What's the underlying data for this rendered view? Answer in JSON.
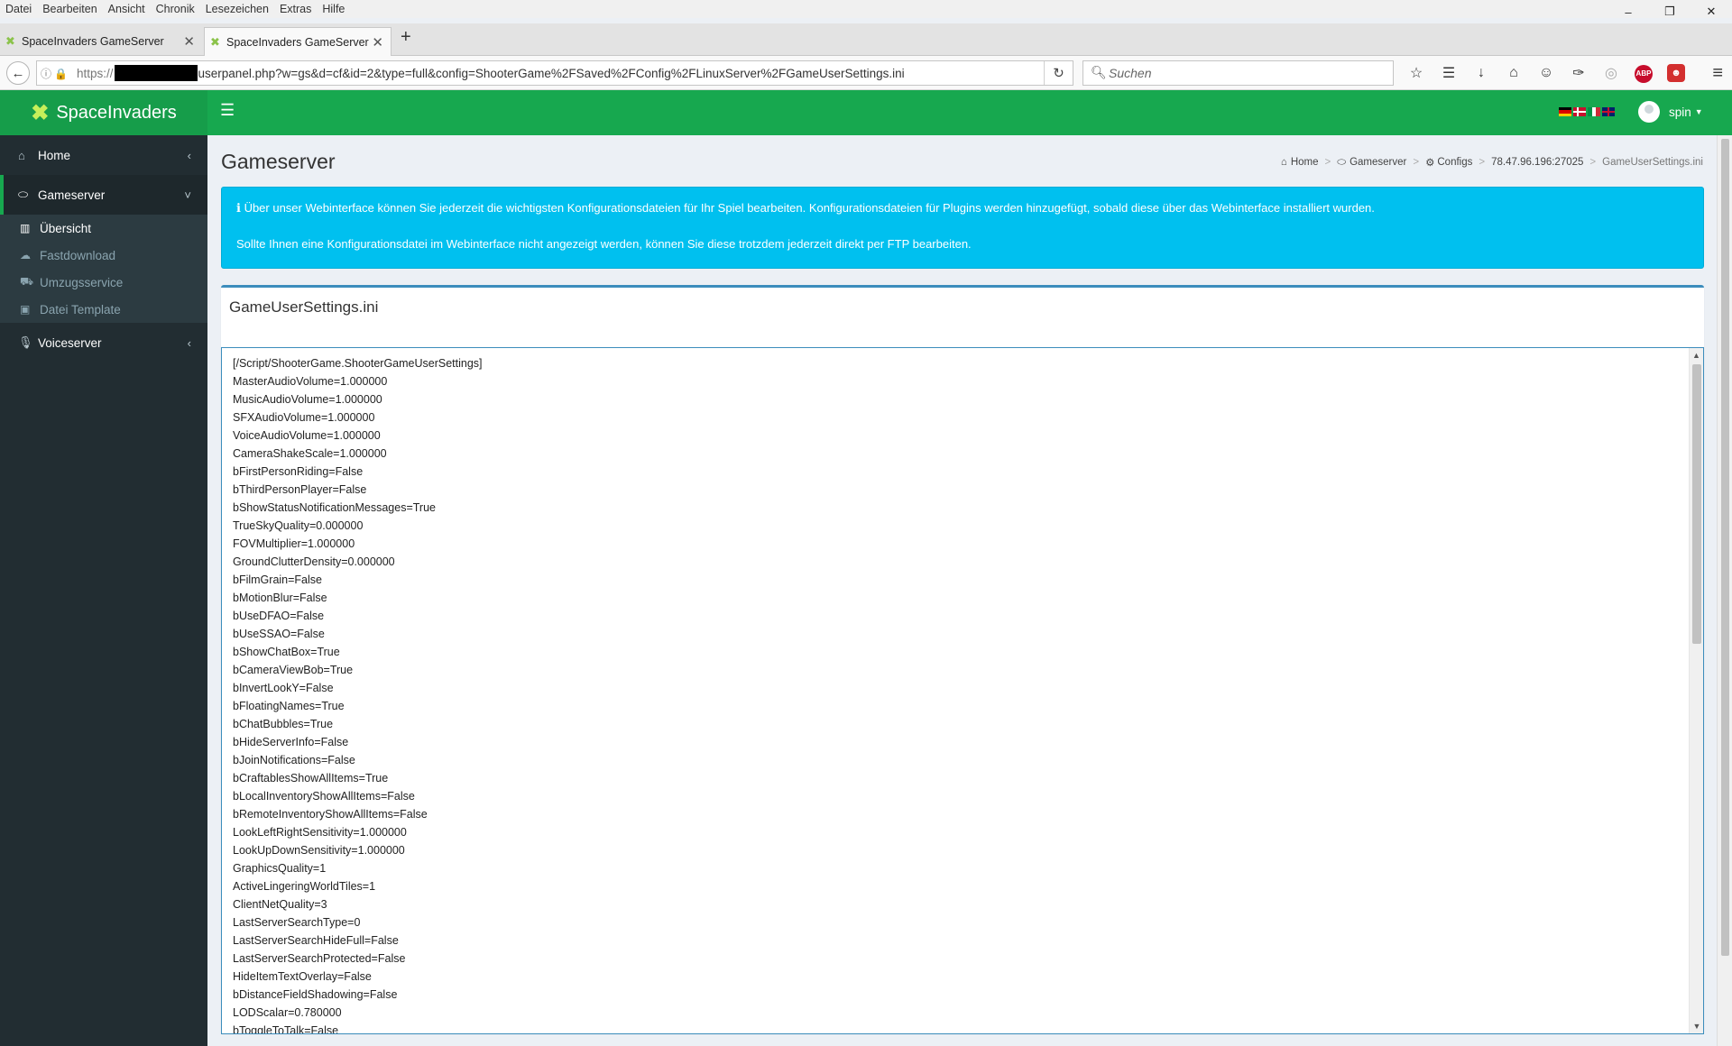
{
  "browser": {
    "menu": [
      "Datei",
      "Bearbeiten",
      "Ansicht",
      "Chronik",
      "Lesezeichen",
      "Extras",
      "Hilfe"
    ],
    "tabs": [
      {
        "title": "SpaceInvaders GameServer",
        "active": false
      },
      {
        "title": "SpaceInvaders GameServer",
        "active": true
      }
    ],
    "url_proto": "https://",
    "url_rest": "userpanel.php?w=gs&d=cf&id=2&type=full&config=ShooterGame%2FSaved%2FConfig%2FLinuxServer%2FGameUserSettings.ini",
    "search_placeholder": "Suchen",
    "toolbar_icons": [
      "bookmark-star-icon",
      "reading-list-icon",
      "download-icon",
      "home-icon",
      "chat-icon",
      "pocket-icon",
      "sync-icon",
      "adblock-icon",
      "extension-icon"
    ],
    "adblock_label": "ABP"
  },
  "app": {
    "brand": "SpaceInvaders",
    "user": "spin",
    "flag_colors": {
      "de": [
        "#000000",
        "#dd0000",
        "#ffce00"
      ],
      "dk": [
        "#c8102e",
        "#ffffff"
      ],
      "it": [
        "#009246",
        "#ffffff",
        "#ce2b37"
      ],
      "uk": [
        "#012169",
        "#ffffff",
        "#c8102e"
      ]
    },
    "accent": "#17a84f",
    "sidebar": {
      "home": "Home",
      "gameserver": "Gameserver",
      "sub": [
        "Übersicht",
        "Fastdownload",
        "Umzugsservice",
        "Datei Template"
      ],
      "voiceserver": "Voiceserver"
    },
    "page_title": "Gameserver",
    "breadcrumb": [
      "Home",
      "Gameserver",
      "Configs",
      "78.47.96.196:27025",
      "GameUserSettings.ini"
    ],
    "alert": [
      "Über unser Webinterface können Sie jederzeit die wichtigsten Konfigurationsdateien für Ihr Spiel bearbeiten. Konfigurationsdateien für Plugins werden hinzugefügt, sobald diese über das Webinterface installiert wurden.",
      "Sollte Ihnen eine Konfigurationsdatei im Webinterface nicht angezeigt werden, können Sie diese trotzdem jederzeit direkt per FTP bearbeiten."
    ],
    "file_title": "GameUserSettings.ini",
    "file_lines": [
      "[/Script/ShooterGame.ShooterGameUserSettings]",
      "MasterAudioVolume=1.000000",
      "MusicAudioVolume=1.000000",
      "SFXAudioVolume=1.000000",
      "VoiceAudioVolume=1.000000",
      "CameraShakeScale=1.000000",
      "bFirstPersonRiding=False",
      "bThirdPersonPlayer=False",
      "bShowStatusNotificationMessages=True",
      "TrueSkyQuality=0.000000",
      "FOVMultiplier=1.000000",
      "GroundClutterDensity=0.000000",
      "bFilmGrain=False",
      "bMotionBlur=False",
      "bUseDFAO=False",
      "bUseSSAO=False",
      "bShowChatBox=True",
      "bCameraViewBob=True",
      "bInvertLookY=False",
      "bFloatingNames=True",
      "bChatBubbles=True",
      "bHideServerInfo=False",
      "bJoinNotifications=False",
      "bCraftablesShowAllItems=True",
      "bLocalInventoryShowAllItems=False",
      "bRemoteInventoryShowAllItems=False",
      "LookLeftRightSensitivity=1.000000",
      "LookUpDownSensitivity=1.000000",
      "GraphicsQuality=1",
      "ActiveLingeringWorldTiles=1",
      "ClientNetQuality=3",
      "LastServerSearchType=0",
      "LastServerSearchHideFull=False",
      "LastServerSearchProtected=False",
      "HideItemTextOverlay=False",
      "bDistanceFieldShadowing=False",
      "LODScalar=0.780000",
      "bToggleToTalk=False"
    ]
  }
}
